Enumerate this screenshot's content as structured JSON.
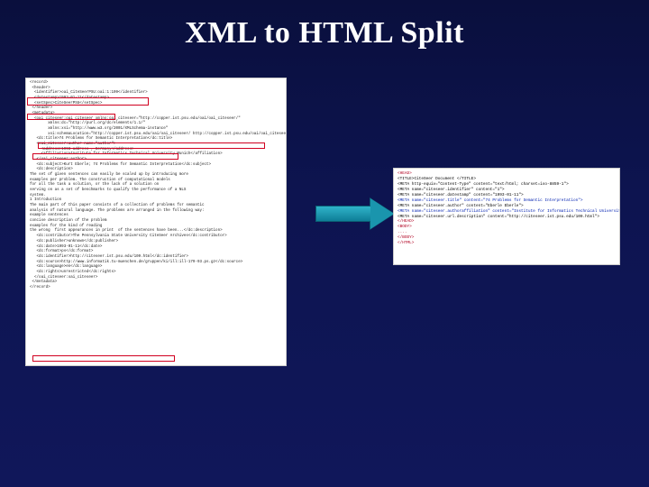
{
  "title": "XML to HTML Split",
  "left_panel": {
    "lines": [
      "<record>",
      " <header>",
      "  <identifier>oai_CiteSeerPSU:oai:1:109</identifier>",
      "  <datestamp>1993-01-11</datestamp>",
      "  <setSpec>CiteSeerPSU</setSpec>",
      " </header>",
      " <metadata>",
      "  <oai_citeseer:oai_citeseer xmlns:oai_citeseer=\"http://copper.ist.psu.edu/oai/oai_citeseer/\"",
      "        xmlns:dc=\"http://purl.org/dc/elements/1.1/\"",
      "        xmlns:xsi=\"http://www.w3.org/2001/XMLSchema-instance\"",
      "        xsi:schemaLocation=\"http://copper.ist.psu.edu/oai/oai_citeseer/ http://copper.ist.psu.edu/oai/oai_citeseer.xsd\">",
      "   <dc:title>74 Problems for Semantic Interpretation</dc:title>",
      "   <oai_citeseer:author name=\"author\">",
      "     <address>1993 address , Germany</address>",
      "     <affiliation>Institute for Informatics Technical University Munich</affiliation>",
      "   </oai_citeseer:author>",
      "   <dc:subject>Kurt Eberle; 74 Problems for Semantic Interpretation</dc:subject>",
      "   <dc:description>",
      "The set of given sentences can easily be scaled up by introducing more",
      "examples per problem. The construction of computational models",
      "for all the task a solution, or the lack of a solution on",
      "serving on as a set of benchmarks to qualify the performance of a NLS",
      "system.",
      "1 Introduction",
      "The main part of this paper consists of a collection of problems for semantic",
      "analysis of natural language. The problems are arranged in the following way:",
      "example sentences",
      "concise description of the problem",
      "examples for the kind of reading",
      "the wrong  first appearances in print  of the sentences have been...</dc:description>",
      "   <dc:contributor>The Pennsylvania State University CiteSeer Archives</dc:contributor>",
      "   <dc:publisher>unknown</dc:publisher>",
      "   <dc:date>1993-01-11</dc:date>",
      "   <dc:format>ps</dc:format>",
      "   <dc:identifier>http://citeseer.ist.psu.edu/109.html</dc:identifier>",
      "   <dc:source>http://www.informatik.tu-muenchen.de/gruppen/ki/ill:ill-179-93.ps.gz</dc:source>",
      "   <dc:language>en</dc:language>",
      "   <dc:rights>unrestricted</dc:rights>",
      "  </oai_citeseer:oai_citeseer>",
      " </metadata>",
      "</record>"
    ]
  },
  "right_panel": {
    "lines": [
      {
        "cls": "hl-red",
        "t": "<HEAD>"
      },
      {
        "cls": "dark",
        "t": "<TITLE>CiteSeer Document </TITLE>"
      },
      {
        "cls": "dark",
        "t": "<META http-equiv=\"Content-Type\" content=\"text/html; charset=iso-8859-1\">"
      },
      {
        "cls": "dark",
        "t": "<META name=\"citeseer.identifier\" content=\"1\">"
      },
      {
        "cls": "dark",
        "t": "<META name=\"citeseer.datestamp\" content=\"1993-01-11\">"
      },
      {
        "cls": "hl-blue",
        "t": "<META name=\"citeseer.title\" content=\"74 Problems for Semantic Interpretation\">"
      },
      {
        "cls": "dark",
        "t": "<META name=\"citeseer.author\" content=\"Eberle Eberle\">"
      },
      {
        "cls": "hl-blue",
        "t": "<META name=\"citeseer.authoraffiliation\" content=\"Institute for Informatics Technical University Munich\">"
      },
      {
        "cls": "dark",
        "t": "<META name=\"citeseer.url.description\" content=\"http://citeseer.ist.psu.edu/109.html\">"
      },
      {
        "cls": "hl-red",
        "t": "</HEAD>"
      },
      {
        "cls": "hl-red",
        "t": "<BODY>"
      },
      {
        "cls": "hl-red",
        "t": "...."
      },
      {
        "cls": "hl-red",
        "t": "</BODY>"
      },
      {
        "cls": "hl-red",
        "t": "</HTML>"
      }
    ]
  },
  "arrow": {
    "direction": "right",
    "color_top": "#2fb3c9",
    "color_bottom": "#0e7e97"
  }
}
